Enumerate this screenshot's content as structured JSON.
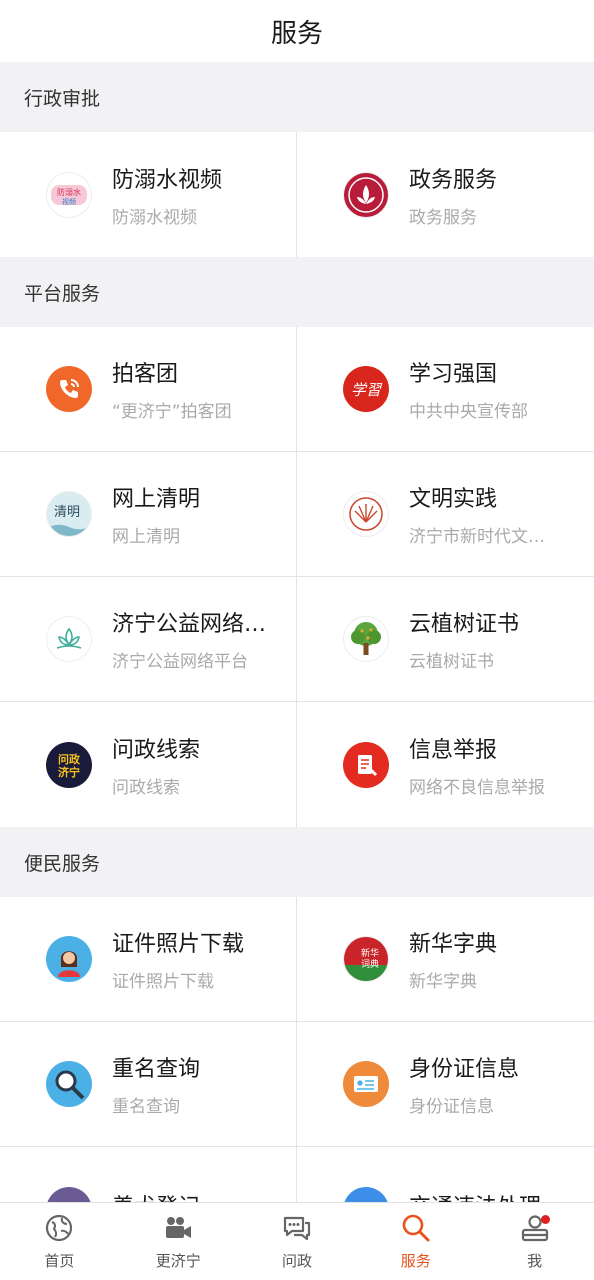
{
  "header": {
    "title": "服务"
  },
  "sections": [
    {
      "title": "行政审批",
      "items": [
        {
          "title": "防溺水视频",
          "subtitle": "防溺水视频",
          "icon": "drowning-prevention-icon"
        },
        {
          "title": "政务服务",
          "subtitle": "政务服务",
          "icon": "government-service-icon"
        }
      ]
    },
    {
      "title": "平台服务",
      "items": [
        {
          "title": "拍客团",
          "subtitle": "“更济宁”拍客团",
          "icon": "phone-icon"
        },
        {
          "title": "学习强国",
          "subtitle": "中共中央宣传部",
          "icon": "xuexi-icon"
        },
        {
          "title": "网上清明",
          "subtitle": "网上清明",
          "icon": "qingming-icon"
        },
        {
          "title": "文明实践",
          "subtitle": "济宁市新时代文…",
          "icon": "civilization-icon"
        },
        {
          "title": "济宁公益网络…",
          "subtitle": "济宁公益网络平台",
          "icon": "lotus-icon"
        },
        {
          "title": "云植树证书",
          "subtitle": "云植树证书",
          "icon": "tree-icon"
        },
        {
          "title": "问政线索",
          "subtitle": "问政线索",
          "icon": "wenzheng-icon"
        },
        {
          "title": "信息举报",
          "subtitle": "网络不良信息举报",
          "icon": "report-icon"
        }
      ]
    },
    {
      "title": "便民服务",
      "items": [
        {
          "title": "证件照片下载",
          "subtitle": "证件照片下载",
          "icon": "id-photo-icon"
        },
        {
          "title": "新华字典",
          "subtitle": "新华字典",
          "icon": "dictionary-icon"
        },
        {
          "title": "重名查询",
          "subtitle": "重名查询",
          "icon": "name-search-icon"
        },
        {
          "title": "身份证信息",
          "subtitle": "身份证信息",
          "icon": "id-card-icon"
        },
        {
          "title": "养犬登记",
          "subtitle": "",
          "icon": "dog-icon"
        },
        {
          "title": "交通违法处理",
          "subtitle": "",
          "icon": "traffic-icon"
        }
      ]
    }
  ],
  "tabbar": {
    "items": [
      {
        "label": "首页",
        "icon": "globe-icon"
      },
      {
        "label": "更济宁",
        "icon": "video-camera-icon"
      },
      {
        "label": "问政",
        "icon": "chat-icon"
      },
      {
        "label": "服务",
        "icon": "search-icon",
        "active": true
      },
      {
        "label": "我",
        "icon": "user-icon",
        "badge": true
      }
    ]
  },
  "colors": {
    "accent": "#e8521b",
    "badge": "#e02020"
  }
}
